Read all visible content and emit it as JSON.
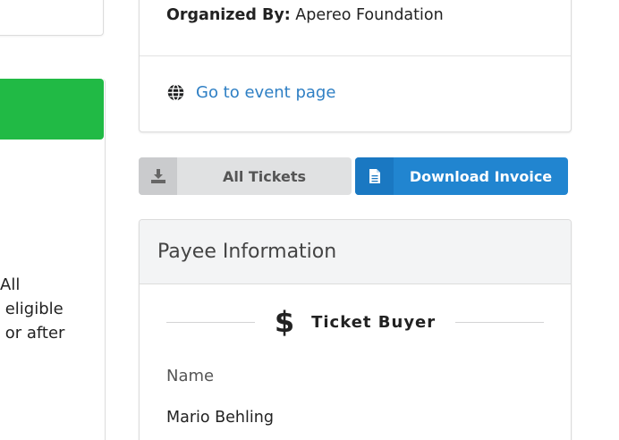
{
  "event": {
    "organized_by_label": "Organized By:",
    "organized_by_value": "Apereo Foundation",
    "event_link": "Go to event page"
  },
  "left": {
    "lines": [
      "All",
      " eligible",
      " or after"
    ],
    "accent_color": "#21ba45"
  },
  "actions": {
    "all_tickets": "All Tickets",
    "download_invoice": "Download Invoice",
    "primary_color": "#2185d0"
  },
  "payee": {
    "header": "Payee Information",
    "section_icon": "$",
    "section_title": "Ticket Buyer",
    "name_label": "Name",
    "name_value": "Mario Behling"
  },
  "icons": [
    "globe-icon",
    "download-icon",
    "file-icon",
    "dollar-icon"
  ]
}
